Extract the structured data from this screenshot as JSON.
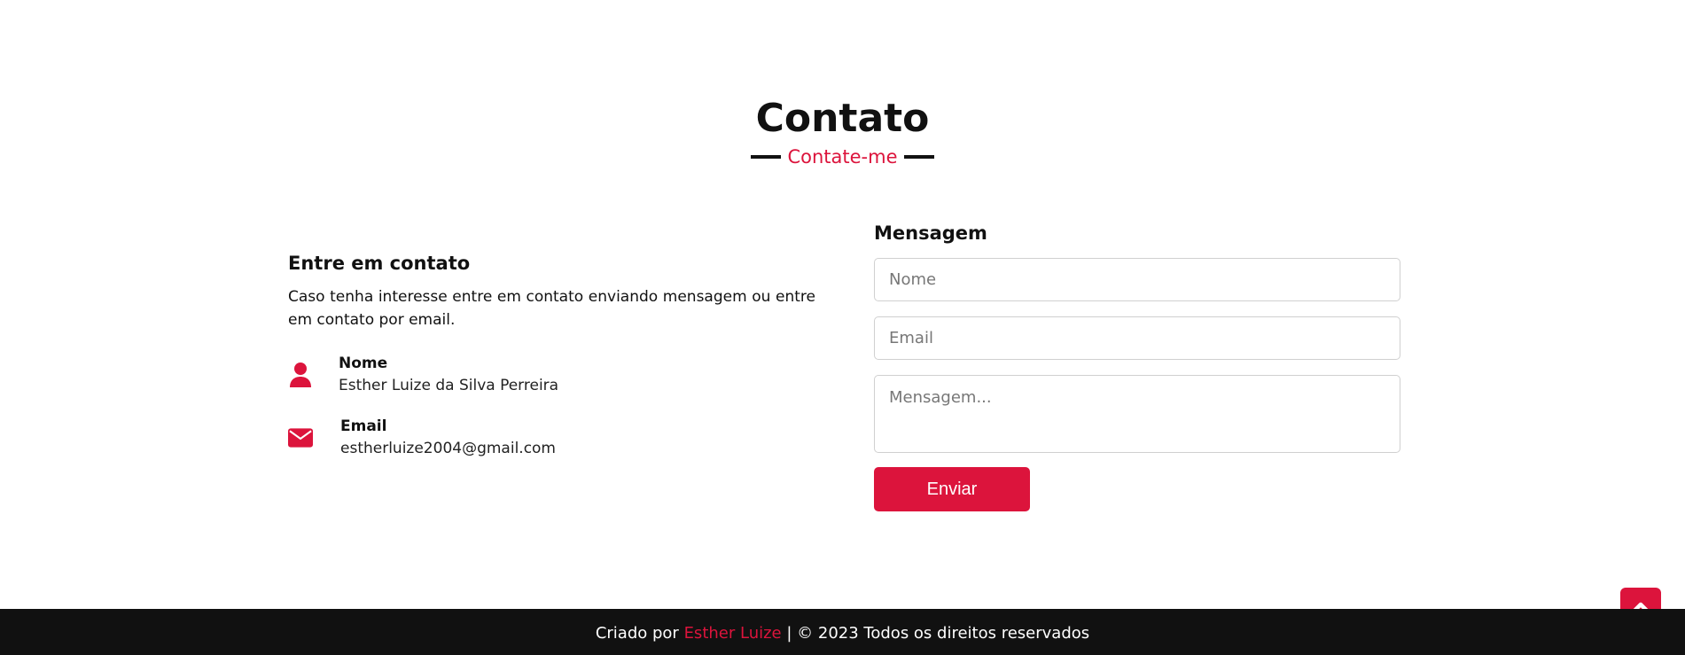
{
  "header": {
    "title": "Contato",
    "subtitle": "Contate-me"
  },
  "contact_info": {
    "title": "Entre em contato",
    "description": "Caso tenha interesse entre em contato enviando mensagem ou entre em contato por email.",
    "items": [
      {
        "icon": "user-icon",
        "label": "Nome",
        "value": "Esther Luize da Silva Perreira"
      },
      {
        "icon": "envelope-icon",
        "label": "Email",
        "value": "estherluize2004@gmail.com"
      }
    ]
  },
  "form": {
    "title": "Mensagem",
    "name_placeholder": "Nome",
    "email_placeholder": "Email",
    "message_placeholder": "Mensagem...",
    "submit_label": "Enviar"
  },
  "footer": {
    "prefix": "Criado por",
    "author": "Esther Luize",
    "separator": "|",
    "copyright_symbol": "©",
    "suffix": "2023 Todos os direitos reservados"
  },
  "scroll_top": {
    "icon": "chevron-up-icon"
  },
  "colors": {
    "accent": "#dc143c",
    "footer_bg": "#111111",
    "text": "#111111"
  }
}
